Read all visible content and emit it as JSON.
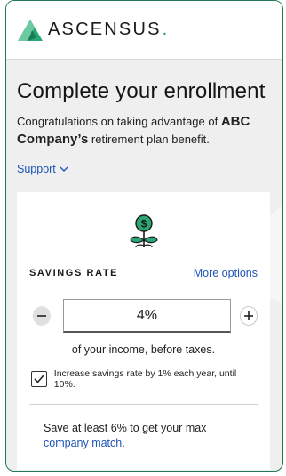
{
  "brand": {
    "name": "ASCENSUS",
    "trademark_dot": "."
  },
  "page": {
    "title": "Complete your enrollment",
    "intro_prefix": "Congratulations on taking advantage of ",
    "intro_company": "ABC Company’s",
    "intro_suffix": " retirement plan benefit.",
    "support_label": "Support"
  },
  "savings": {
    "label": "SAVINGS RATE",
    "more_options": "More options",
    "rate_value": "4%",
    "income_note": "of your income, before taxes.",
    "auto_increase_label": "Increase savings rate by 1% each year, until 10%.",
    "auto_increase_checked": true,
    "match_prefix": "Save at least 6% to get your max ",
    "match_link": "company match",
    "match_suffix": "."
  },
  "colors": {
    "accent": "#1f9a6a",
    "link": "#1e54b5",
    "frame": "#1f7a55"
  },
  "icons": [
    "ascensus-logo-icon",
    "chevron-down-icon",
    "money-plant-icon",
    "minus-icon",
    "plus-icon",
    "checkmark-icon"
  ]
}
